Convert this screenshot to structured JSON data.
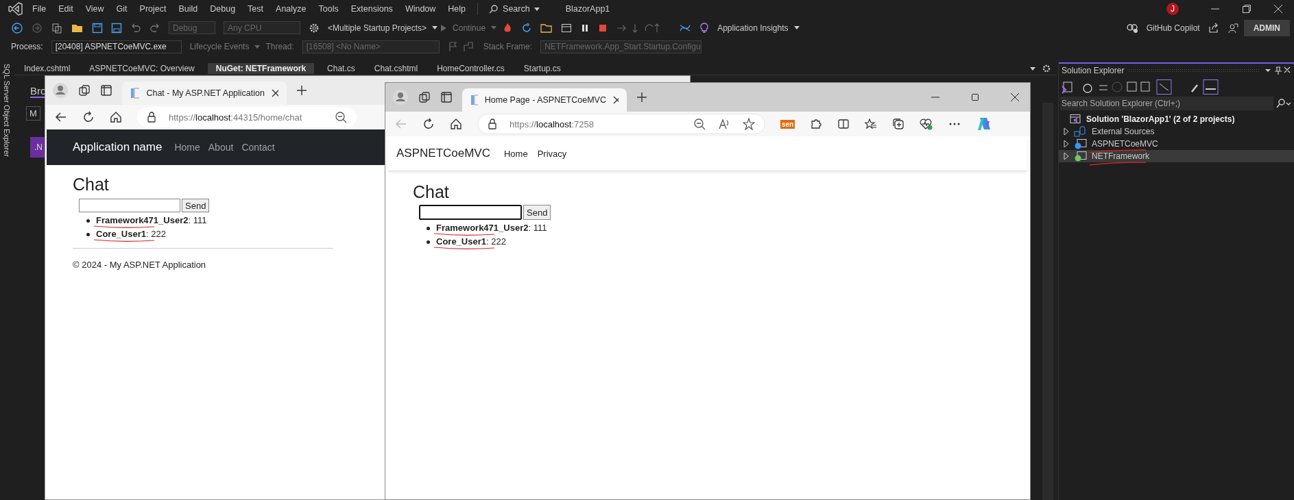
{
  "ide": {
    "menu": [
      "File",
      "Edit",
      "View",
      "Git",
      "Project",
      "Build",
      "Debug",
      "Test",
      "Analyze",
      "Tools",
      "Extensions",
      "Window",
      "Help"
    ],
    "search": "Search",
    "title": "BlazorApp1",
    "avatar": "J",
    "copilot": "GitHub Copilot",
    "admin": "ADMIN",
    "toolbar": {
      "configuration": "Debug",
      "platform": "Any CPU",
      "startup": "<Multiple Startup Projects>",
      "continue": "Continue",
      "insights": "Application Insights"
    },
    "debug_bar": {
      "process_label": "Process:",
      "process": "[20408] ASPNETCoeMVC.exe",
      "lifecycle": "Lifecycle Events",
      "thread_label": "Thread:",
      "thread": "[16508] <No Name>",
      "stack_label": "Stack Frame:",
      "stack": "NETFramework.App_Start.Startup.Configu"
    },
    "tabs": [
      {
        "label": "Index.cshtml",
        "selected": false
      },
      {
        "label": "ASPNETCoeMVC: Overview",
        "selected": false
      },
      {
        "label": "NuGet: NETFramework",
        "selected": true
      },
      {
        "label": "Chat.cs",
        "selected": false
      },
      {
        "label": "Chat.cshtml",
        "selected": false
      },
      {
        "label": "HomeController.cs",
        "selected": false
      },
      {
        "label": "Startup.cs",
        "selected": false
      }
    ],
    "side_tab": "SQL Server Object Explorer",
    "background_doc": {
      "tab": "Bro",
      "field": "M",
      "tile": ".N"
    }
  },
  "browsers": [
    {
      "tab_title": "Chat - My ASP.NET Application",
      "scheme": "https://",
      "host": "localhost",
      "path": ":44315/home/chat",
      "kind": "dark",
      "window_controls": false,
      "extensions": false,
      "brand": "Application name",
      "nav": [
        "Home",
        "About",
        "Contact"
      ],
      "heading": "Chat",
      "send": "Send",
      "messages": [
        {
          "user": "Framework471_User2",
          "text": ": 111",
          "annotated": true
        },
        {
          "user": "Core_User1",
          "text": ": 222",
          "annotated": true
        }
      ],
      "footer": "© 2024 - My ASP.NET Application"
    },
    {
      "tab_title": "Home Page - ASPNETCoeMVC",
      "scheme": "https://",
      "host": "localhost",
      "path": ":7258",
      "kind": "light",
      "window_controls": true,
      "extensions": true,
      "extension_label": "sen",
      "brand": "ASPNETCoeMVC",
      "nav": [
        "Home",
        "Privacy"
      ],
      "heading": "Chat",
      "send": "Send",
      "messages": [
        {
          "user": "Framework471_User2",
          "text": ": 111",
          "annotated": true
        },
        {
          "user": "Core_User1",
          "text": ": 222",
          "annotated": true
        }
      ]
    }
  ],
  "solution_explorer": {
    "title": "Solution Explorer",
    "search": {
      "placeholder": "Search Solution Explorer (Ctrl+;)"
    },
    "tree": [
      {
        "label": "Solution 'BlazorApp1' (2 of 2 projects)",
        "kind": "solution",
        "selected": false,
        "children": [
          {
            "label": "External Sources",
            "kind": "external",
            "expanded": false,
            "selected": false,
            "annotated": false
          },
          {
            "label": "ASPNETCoeMVC",
            "kind": "project",
            "color": "#3794ff",
            "expanded": false,
            "selected": false,
            "annotated": true
          },
          {
            "label": "NETFramework",
            "kind": "project",
            "color": "#6ccb5f",
            "expanded": false,
            "selected": true,
            "annotated": true
          }
        ]
      }
    ]
  }
}
